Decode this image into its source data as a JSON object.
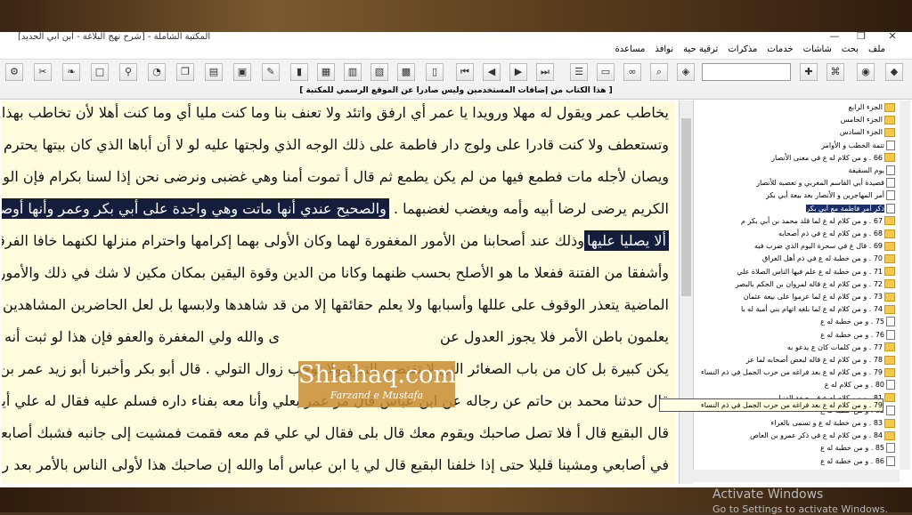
{
  "window": {
    "title": "المكتبة الشاملة - [شرح نهج البلاغة - ابن ابي الحديد]",
    "controls": [
      "—",
      "❐",
      "✕"
    ]
  },
  "menu": [
    "ملف",
    "بحث",
    "شاشات",
    "خدمات",
    "مذكرات",
    "ترقية حية",
    "نوافذ",
    "مساعدة"
  ],
  "notice": "[ هذا الكتاب من إضافات المستخدمين وليس صادرا عن الموقع الرسمي للمكتبة ]",
  "reader": {
    "lines": [
      "يخاطب عمر ويقول له مهلا ورويدا يا عمر أي ارفق واتئد ولا تعنف بنا وما كنت مليا أي وما كنت أهلا لأن تخاطب بهذا",
      "وتستعطف ولا كنت قادرا على ولوج دار فاطمة على ذلك الوجه الذي ولجتها عليه لو لا أن أباها الذي كان بيتها يحترم",
      "ويصان لأجله مات فطمع فيها من لم يكن يطمع ثم قال أ تموت أمنا وهي غضبى ونرضى نحن إذا لسنا بكرام فإن الولد",
      "الكريم يرضى لرضا أبيه وأمه ويغضب لغضبهما .",
      "ألا يصليا عليها",
      "وأشفقا من الفتنة ففعلا ما هو الأصلح بحسب ظنهما وكانا من الدين وقوة اليقين بمكان مكين لا شك في ذلك والأمور",
      "الماضية يتعذر الوقوف على عللها وأسبابها ولا يعلم حقائقها إلا من قد شاهدها ولابسها بل لعل الحاضرين المشاهدين لها",
      "يعلمون باطن الأمر فلا يجوز العدول عن",
      "ى والله ولي المغفرة والعفو فإن هذا لو ثبت أنه خطأ لم",
      "يكن كبيرة بل كان من باب الصغائر التي لا تقتضي التبرؤ ولا توجب زوال التولي . قال أبو بكر وأخبرنا أبو زيد عمر بن شبة",
      "قال حدثنا محمد بن حاتم عن رجاله عن ابن عباس قال مر عمر بعلي وأنا معه بفناء داره فسلم عليه فقال له علي أين تريد",
      "قال البقيع قال أ فلا تصل صاحبك ويقوم معك قال بلى فقال لي علي قم معه فقمت فمشيت إلى جانبه فشبك أصابعه",
      "في أصابعي ومشينا قليلا حتى إذا خلفنا البقيع قال لي يا ابن عباس أما والله إن صاحبك هذا لأولى الناس بالأمر بعد رسول"
    ],
    "highlight_1": "والصحيح عندي أنها ماتت وهي واجدة على أبي بكر وعمر وأنها أوصت",
    "line5_rest": "وذلك عند أصحابنا من الأمور المغفورة لهما وكان الأولى بهما إكرامها واحترام منزلها لكنهما خافا الفرقة"
  },
  "watermark": {
    "site": "Shiahaq.com",
    "by": "Farzand e Mustafa"
  },
  "tree": {
    "nodes": [
      {
        "label": "الجزء الرابع",
        "kind": "folder"
      },
      {
        "label": "الجزء الخامس",
        "kind": "folder"
      },
      {
        "label": "الجزء السادس",
        "kind": "folder"
      },
      {
        "label": "تتمة الخطب و الأوامر",
        "kind": "doc"
      },
      {
        "label": "66 . و من كلام له ع في معنى الأنصار",
        "kind": "folder"
      },
      {
        "label": "يوم السقيفة",
        "kind": "doc"
      },
      {
        "label": "قصيدة أبي القاسم المغربي و تعصبه للأنصار",
        "kind": "doc"
      },
      {
        "label": "أمر المهاجرين و الأنصار بعد بيعة أبي بكر",
        "kind": "doc"
      },
      {
        "label": "ذكر أمر فاطمة مع أبي بكر",
        "kind": "doc",
        "selected": true
      },
      {
        "label": "67 . و من كلام له ع لما قلد محمد بن أبي بكر م",
        "kind": "folder"
      },
      {
        "label": "68 . و من كلام له ع في ذم أصحابه",
        "kind": "folder"
      },
      {
        "label": "69 . قال ع في سحرة اليوم الذي ضرب فيه",
        "kind": "folder"
      },
      {
        "label": "70 . و من خطبة له ع في ذم أهل العراق",
        "kind": "folder"
      },
      {
        "label": "71 . و من خطبة له ع علم فيها الناس الصلاة علي",
        "kind": "folder"
      },
      {
        "label": "72 . و من كلام له ع قاله لمروان بن الحكم بالبصر",
        "kind": "folder"
      },
      {
        "label": "73 . و من كلام له ع لما عزموا على بيعة عثمان",
        "kind": "folder"
      },
      {
        "label": "74 . و من كلام له ع لما بلغه اتهام بني أمية له با",
        "kind": "folder"
      },
      {
        "label": "75 . و من خطبة له ع",
        "kind": "doc"
      },
      {
        "label": "76 . و من خطبة له ع",
        "kind": "doc"
      },
      {
        "label": "77 . و من كلمات كان ع يدعو به",
        "kind": "folder"
      },
      {
        "label": "78 . و من كلام له ع قاله لبعض أصحابه لما عز",
        "kind": "folder"
      },
      {
        "label": "79 . و من كلام له ع بعد فراغه من حرب الجمل في ذم النساء",
        "kind": "folder"
      },
      {
        "label": "80 . و من كلام له ع",
        "kind": "doc"
      },
      {
        "label": "81 . و من كلام له ع في صفة الدنيا",
        "kind": "folder"
      },
      {
        "label": "82 . و من خطبة له ع",
        "kind": "doc"
      },
      {
        "label": "83 . و من خطبة له ع و تسمى بالغراء",
        "kind": "folder"
      },
      {
        "label": "84 . و من كلام له ع في ذكر عمرو بن العاص",
        "kind": "folder"
      },
      {
        "label": "85 . و من خطبة له ع",
        "kind": "doc"
      },
      {
        "label": "86 . و من خطبة له ع",
        "kind": "doc"
      }
    ],
    "tooltip": "79 . و من كلام له ع بعد فراغه من حرب الجمل في ذم النساء"
  },
  "os": {
    "activate": "Activate Windows",
    "activate_sub": "Go to Settings to activate Windows."
  }
}
